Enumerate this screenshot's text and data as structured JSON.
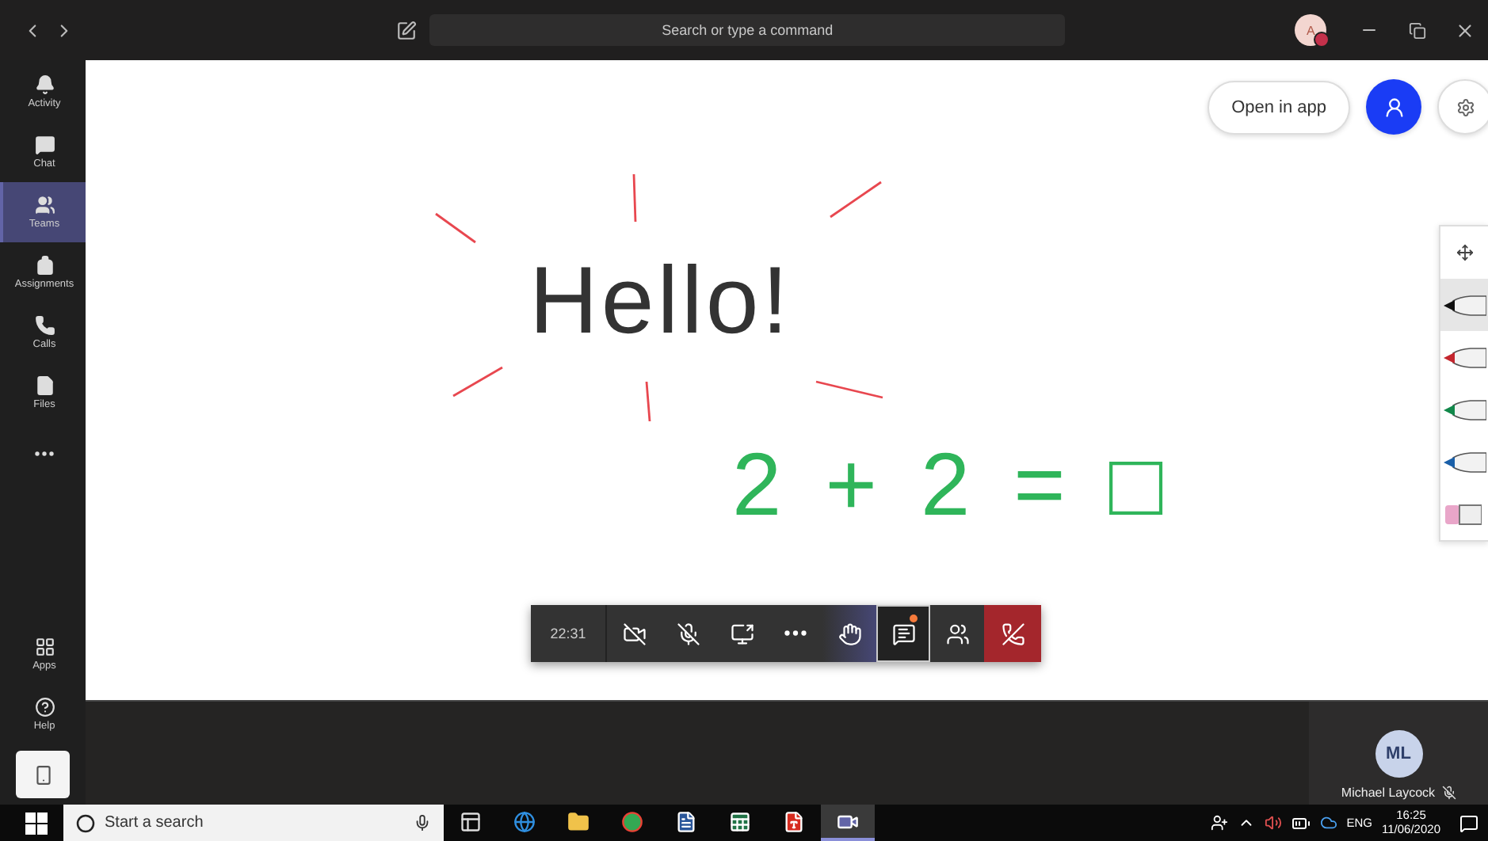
{
  "title_bar": {
    "search_placeholder": "Search or type a command",
    "avatar": "A"
  },
  "sidebar": {
    "items": [
      {
        "label": "Activity",
        "selected": false
      },
      {
        "label": "Chat",
        "selected": false
      },
      {
        "label": "Teams",
        "selected": true
      },
      {
        "label": "Assignments",
        "selected": false
      },
      {
        "label": "Calls",
        "selected": false
      },
      {
        "label": "Files",
        "selected": false
      }
    ],
    "bottom_items": [
      {
        "label": "Apps"
      },
      {
        "label": "Help"
      }
    ]
  },
  "whiteboard": {
    "open_button": "Open in app",
    "ink_text": [
      {
        "text": "Hello!",
        "color": "#333333"
      },
      {
        "text": "2 + 2 = □",
        "color": "#2fb55a"
      }
    ],
    "tools": [
      {
        "kind": "move",
        "selected": false
      },
      {
        "kind": "pen",
        "color": "#111111",
        "selected": true
      },
      {
        "kind": "pen",
        "color": "#c4262e",
        "selected": false
      },
      {
        "kind": "pen",
        "color": "#11884a",
        "selected": false
      },
      {
        "kind": "pen",
        "color": "#1a5fa8",
        "selected": false
      },
      {
        "kind": "eraser",
        "color": "#e9a6c9",
        "selected": false
      }
    ]
  },
  "call_controls": {
    "timer": "22:31",
    "buttons": [
      {
        "kind": "camera",
        "active": false,
        "focused": false,
        "unread": false
      },
      {
        "kind": "mic",
        "active": false,
        "focused": false,
        "unread": false
      },
      {
        "kind": "share",
        "active": false,
        "focused": false,
        "unread": false
      },
      {
        "kind": "more",
        "active": false,
        "focused": false,
        "unread": false
      },
      {
        "kind": "hand",
        "active": true,
        "focused": false,
        "unread": false
      },
      {
        "kind": "chat",
        "active": false,
        "focused": true,
        "unread": true
      },
      {
        "kind": "people",
        "active": false,
        "focused": false,
        "unread": false
      },
      {
        "kind": "hangup",
        "active": false,
        "focused": false,
        "unread": false
      }
    ]
  },
  "participant": {
    "initials": "ML",
    "name": "Michael Laycock"
  },
  "taskbar": {
    "search_placeholder": "Start a search",
    "apps": [
      {
        "kind": "taskview",
        "selected": false
      },
      {
        "kind": "browser",
        "selected": false
      },
      {
        "kind": "folder",
        "selected": false
      },
      {
        "kind": "globe",
        "selected": false
      },
      {
        "kind": "document",
        "selected": false
      },
      {
        "kind": "spreadsheet",
        "selected": false
      },
      {
        "kind": "pdf",
        "selected": false
      },
      {
        "kind": "meeting",
        "selected": true
      }
    ],
    "language": "ENG",
    "time": "16:25",
    "date": "11/06/2020"
  }
}
